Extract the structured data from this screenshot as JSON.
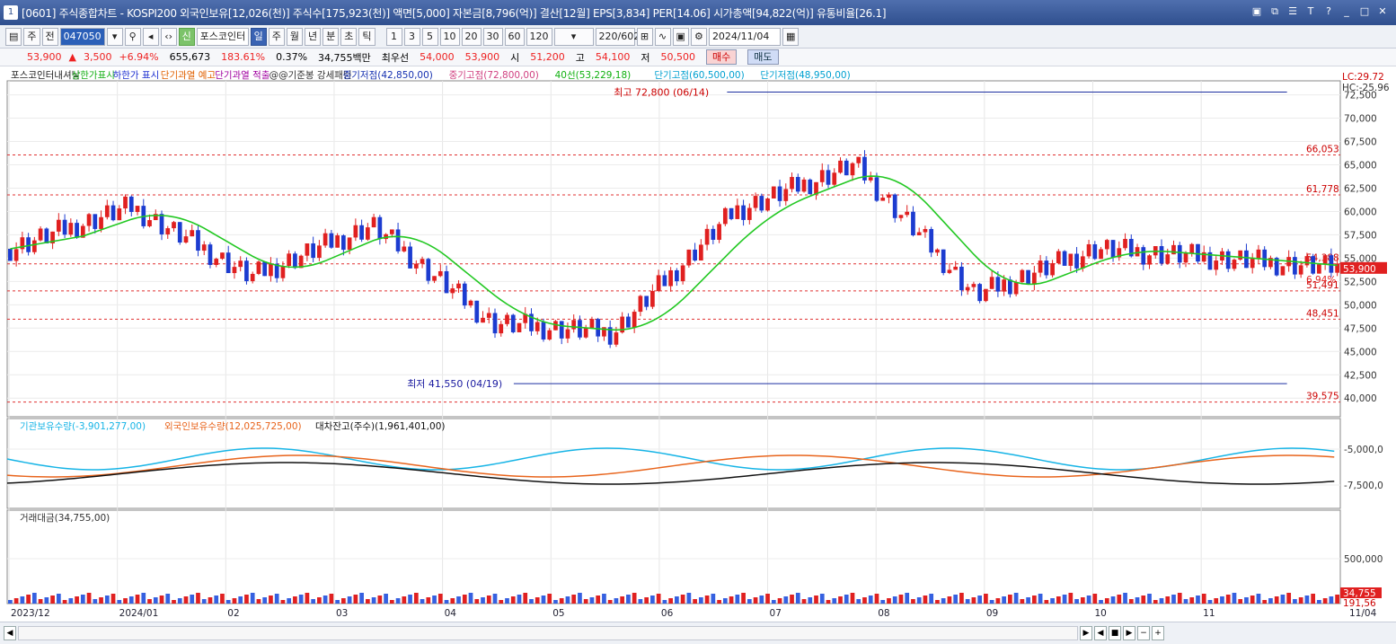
{
  "window": {
    "number": "1",
    "title": "[0601] 주식종합차트 - KOSPI200 외국인보유[12,026(천)] 주식수[175,923(천)] 액면[5,000] 자본금[8,796(억)] 결산[12월] EPS[3,834] PER[14.06] 시가총액[94,822(억)] 유통비율[26.1]"
  },
  "toolbar": {
    "market": "주",
    "all": "전",
    "code": "047050",
    "stock_name": "포스코인터",
    "periods": [
      "일",
      "주",
      "월",
      "년",
      "분",
      "초",
      "틱"
    ],
    "minute_options": [
      "1",
      "3",
      "5",
      "10",
      "20",
      "30",
      "60",
      "120"
    ],
    "count": "220/602",
    "date": "2024/11/04"
  },
  "quote": {
    "price": "53,900",
    "arrow": "▲",
    "change": "3,500",
    "pct": "+6.94%",
    "volume": "655,673",
    "vol_ratio": "183.61%",
    "turnover": "0.37%",
    "amount": "34,755백만",
    "best": "최우선",
    "ask": "54,000",
    "bid": "53,900",
    "open_label": "시",
    "open": "51,200",
    "high_label": "고",
    "high": "54,100",
    "low_label": "저",
    "low": "50,500",
    "buy": "매수",
    "sell": "매도"
  },
  "legend": {
    "items": [
      "포스코인터내셔날",
      "상한가표시",
      "하한가 표시",
      "단기과열 예고",
      "단기과열 적출",
      "@@기준봉 강세패턴",
      "중기저점(42,850,00)",
      "중기고점(72,800,00)",
      "40선(53,229,18)",
      "단기고점(60,500,00)",
      "단기저점(48,950,00)"
    ],
    "colors": [
      "#222222",
      "#18b018",
      "#1c2fd0",
      "#e06000",
      "#a000a0",
      "#333333",
      "#1530b0",
      "#d04080",
      "#10b010",
      "#00a0d0",
      "#00a0d0"
    ]
  },
  "price_panel": {
    "yticks": [
      "72,500",
      "70,000",
      "67,500",
      "65,000",
      "62,500",
      "60,000",
      "57,500",
      "55,000",
      "52,500",
      "50,000",
      "47,500",
      "45,000",
      "42,500",
      "40,000"
    ],
    "levels": [
      "66,053",
      "61,778",
      "54,388",
      "51,491",
      "48,451",
      "39,575"
    ],
    "current": "53,900",
    "current_pct": "6.94%",
    "lc": "LC:29.72",
    "hc": "HC:-25.96",
    "high_note": "최고 72,800 (06/14)",
    "low_note": "최저 41,550 (04/19)"
  },
  "flow_panel": {
    "legend": [
      "기관보유수량(-3,901,277,00)",
      "외국인보유수량(12,025,725,00)",
      "대차잔고(주수)(1,961,401,00)"
    ],
    "legend_colors": [
      "#16b4e6",
      "#e8641c",
      "#111111"
    ],
    "yticks": [
      "-5,000,0",
      "-7,500,0"
    ]
  },
  "vol_panel": {
    "legend": "거래대금(34,755,00)",
    "yticks": [
      "500,000"
    ],
    "current": "34,755",
    "extra": "191,56"
  },
  "xaxis": {
    "labels": [
      "2023/12",
      "2024/01",
      "02",
      "03",
      "04",
      "05",
      "06",
      "07",
      "08",
      "09",
      "10",
      "11",
      "11/04"
    ]
  },
  "chart_data": {
    "type": "candlestick",
    "title": "포스코인터내셔날",
    "x": [
      "2023/12",
      "2024/01",
      "02",
      "03",
      "04",
      "05",
      "06",
      "07",
      "08",
      "09",
      "10",
      "11"
    ],
    "close": [
      56000,
      60500,
      53000,
      58500,
      48000,
      47000,
      60000,
      65000,
      51000,
      56000,
      55000,
      53900
    ],
    "high_marker": 72800,
    "low_marker": 41550,
    "levels": [
      66053,
      61778,
      54388,
      51491,
      48451,
      39575
    ],
    "ylim": [
      38000,
      74000
    ]
  }
}
